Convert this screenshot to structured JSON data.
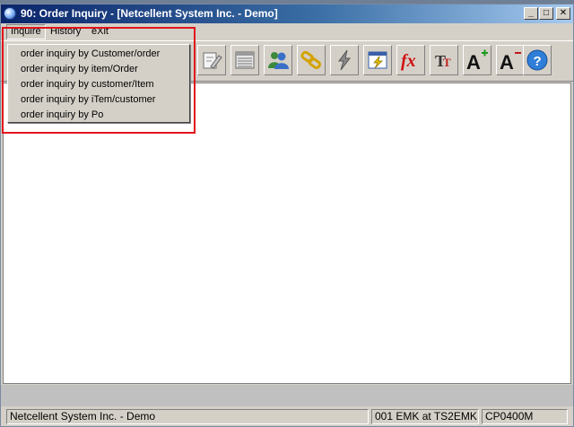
{
  "window": {
    "title": "90: Order Inquiry - [Netcellent System Inc. - Demo]",
    "min_label": "_",
    "max_label": "□",
    "close_label": "✕"
  },
  "menubar": {
    "items": [
      {
        "label": "Inquire",
        "state": "open"
      },
      {
        "label": "History"
      },
      {
        "label": "eXit"
      }
    ]
  },
  "inquire_menu": {
    "items": [
      {
        "label": "order inquiry by Customer/order"
      },
      {
        "label": "order inquiry by item/Order"
      },
      {
        "label": "order inquiry by customer/Item"
      },
      {
        "label": "order inquiry by iTem/customer"
      },
      {
        "label": "order inquiry by Po"
      }
    ]
  },
  "toolbar": {
    "buttons": [
      {
        "icon": "edit-icon"
      },
      {
        "icon": "list-icon"
      },
      {
        "icon": "users-icon"
      },
      {
        "icon": "link-icon"
      },
      {
        "icon": "lightning-icon"
      },
      {
        "icon": "window-lightning-icon"
      },
      {
        "icon": "function-icon"
      },
      {
        "icon": "text-size-icon"
      },
      {
        "icon": "font-increase-icon"
      },
      {
        "icon": "font-decrease-icon"
      },
      {
        "icon": "help-icon"
      }
    ]
  },
  "statusbar": {
    "company": "Netcellent System Inc. - Demo",
    "session": "001 EMK at TS2EMK",
    "program": "CP0400M"
  },
  "colors": {
    "highlight_border": "#e0141b",
    "title_gradient_start": "#0a246a"
  }
}
